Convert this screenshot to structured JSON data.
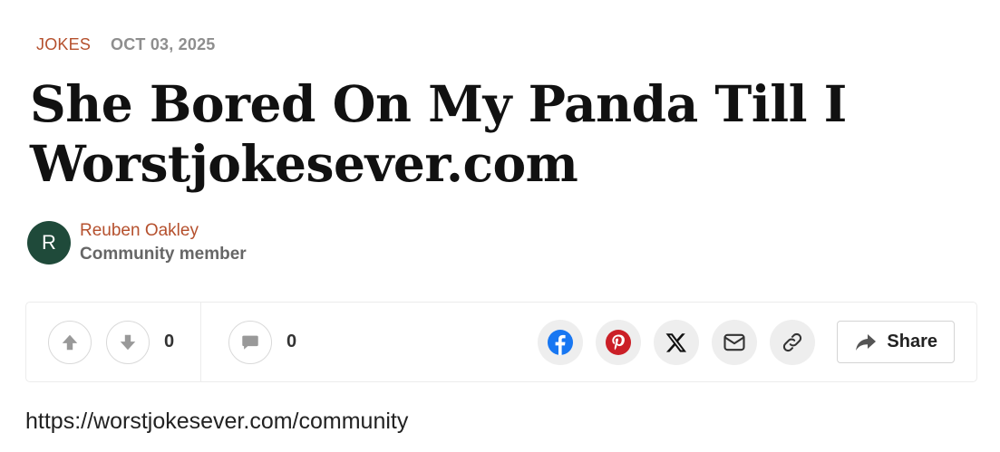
{
  "meta": {
    "category": "JOKES",
    "date": "OCT 03, 2025"
  },
  "article": {
    "title": "She Bored On My Panda Till I Worstjokesever.com",
    "body_text": "https://worstjokesever.com/community"
  },
  "author": {
    "initial": "R",
    "name": "Reuben Oakley",
    "role": "Community member",
    "avatar_color": "#1f4a3a"
  },
  "actions": {
    "vote_count": "0",
    "comment_count": "0",
    "share_label": "Share",
    "icons": {
      "upvote": "arrow-up-icon",
      "downvote": "arrow-down-icon",
      "comment": "speech-bubble-icon",
      "facebook": "facebook-icon",
      "pinterest": "pinterest-icon",
      "x": "x-icon",
      "email": "envelope-icon",
      "link": "link-icon",
      "share": "share-arrow-icon"
    }
  },
  "colors": {
    "accent": "#b5502d",
    "facebook": "#1877f2",
    "pinterest": "#cb1f27"
  }
}
